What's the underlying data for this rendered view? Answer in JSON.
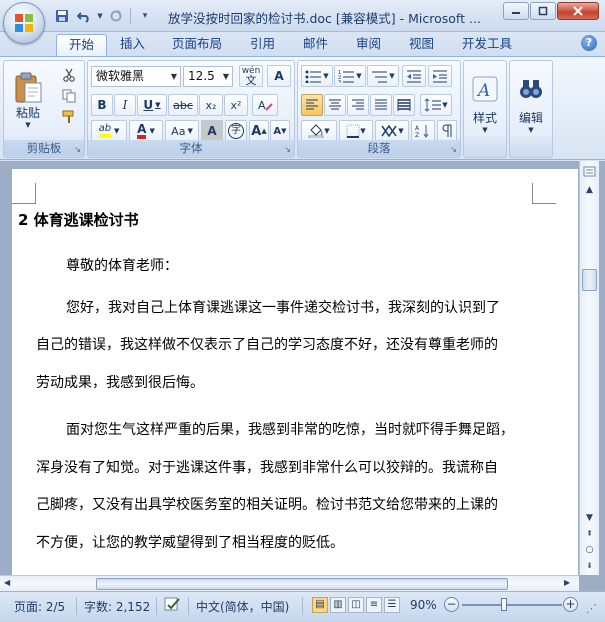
{
  "window": {
    "title": "放学没按时回家的检讨书.doc [兼容模式] - Microsoft ...",
    "controls": [
      "minimize",
      "maximize",
      "close"
    ]
  },
  "quick_access": {
    "save_icon": "save-icon",
    "undo_icon": "undo-icon",
    "redo_icon": "redo-icon"
  },
  "tabs": [
    {
      "label": "开始",
      "active": true
    },
    {
      "label": "插入"
    },
    {
      "label": "页面布局"
    },
    {
      "label": "引用"
    },
    {
      "label": "邮件"
    },
    {
      "label": "审阅"
    },
    {
      "label": "视图"
    },
    {
      "label": "开发工具"
    }
  ],
  "ribbon": {
    "clipboard": {
      "label": "剪贴板",
      "paste": "粘贴"
    },
    "font": {
      "label": "字体",
      "font_name": "微软雅黑",
      "font_size": "12.5",
      "pinyin_btn": "wén",
      "border_btn": "A",
      "bold": "B",
      "italic": "I",
      "underline": "U",
      "strike": "abc",
      "sub": "x₂",
      "sup": "x²",
      "clear": "A",
      "highlight": "ab",
      "font_color": "A",
      "case": "Aa",
      "shade": "A",
      "enclose": "字",
      "grow": "A",
      "shrink": "A"
    },
    "paragraph": {
      "label": "段落"
    },
    "styles": {
      "label": "样式"
    },
    "editing": {
      "label": "编辑"
    }
  },
  "document": {
    "heading_num": "2",
    "heading": "体育逃课检讨书",
    "greeting": "尊敬的体育老师：",
    "p1_line1": "您好，我对自己上体育课逃课这一事件递交检讨书，我深刻的认识到了",
    "p1_line2": "自己的错误，我这样做不仅表示了自己的学习态度不好，还没有尊重老师的",
    "p1_line3": "劳动成果，我感到很后悔。",
    "p2_line1": "面对您生气这样严重的后果，我感到非常的吃惊，当时就吓得手舞足蹈，",
    "p2_line2": "浑身没有了知觉。对于逃课这件事，我感到非常什么可以狡辩的。我谎称自",
    "p2_line3": "己脚疼，又没有出具学校医务室的相关证明。检讨书范文给您带来的上课的",
    "p2_line4": "不方便，让您的教学威望得到了相当程度的贬低。"
  },
  "status": {
    "page": "页面: 2/5",
    "words": "字数: 2,152",
    "language": "中文(简体，中国)",
    "zoom": "90%",
    "zoom_percent": 90
  },
  "colors": {
    "highlight": "#ffff00",
    "font_color": "#e0201a",
    "ribbon_border": "#8db2e3"
  }
}
